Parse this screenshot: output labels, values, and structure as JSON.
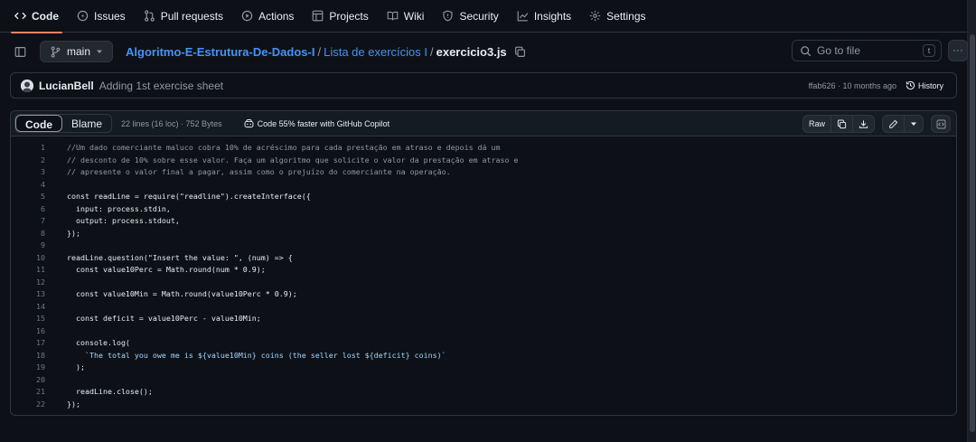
{
  "nav": {
    "tabs": [
      {
        "label": "Code",
        "icon": "code-icon"
      },
      {
        "label": "Issues",
        "icon": "issue-icon"
      },
      {
        "label": "Pull requests",
        "icon": "pull-request-icon"
      },
      {
        "label": "Actions",
        "icon": "play-icon"
      },
      {
        "label": "Projects",
        "icon": "table-icon"
      },
      {
        "label": "Wiki",
        "icon": "book-icon"
      },
      {
        "label": "Security",
        "icon": "shield-icon"
      },
      {
        "label": "Insights",
        "icon": "graph-icon"
      },
      {
        "label": "Settings",
        "icon": "gear-icon"
      }
    ],
    "active_tab": "Code"
  },
  "path": {
    "branch": "main",
    "repo": "Algoritmo-E-Estrutura-De-Dados-I",
    "separator": "/",
    "folder": "Lista de exercícios I",
    "file": "exercicio3.js",
    "goto_placeholder": "Go to file",
    "goto_shortcut": "t",
    "more": "···"
  },
  "commit": {
    "author": "LucianBell",
    "message": "Adding 1st exercise sheet",
    "meta": "ffab626 · 10 months ago",
    "history": "History"
  },
  "file": {
    "tab_code": "Code",
    "tab_blame": "Blame",
    "info": "22 lines (16 loc) · 752 Bytes",
    "copilot": "Code 55% faster with GitHub Copilot",
    "raw": "Raw"
  },
  "code_lines": [
    "//Um dado comerciante maluco cobra 10% de acréscimo para cada prestação em atraso e depois dá um",
    "// desconto de 10% sobre esse valor. Faça um algoritmo que solicite o valor da prestação em atraso e",
    "// apresente o valor final a pagar, assim como o prejuízo do comerciante na operação.",
    "",
    "const readLine = require(\"readline\").createInterface({",
    "  input: process.stdin,",
    "  output: process.stdout,",
    "});",
    "",
    "readLine.question(\"Insert the value: \", (num) => {",
    "  const value10Perc = Math.round(num * 0.9);",
    "",
    "  const value10Min = Math.round(value10Perc * 0.9);",
    "",
    "  const deficit = value10Perc - value10Min;",
    "",
    "  console.log(",
    "    `The total you owe me is ${value10Min} coins (the seller lost ${deficit} coins)`",
    "  );",
    "",
    "  readLine.close();",
    "});"
  ]
}
